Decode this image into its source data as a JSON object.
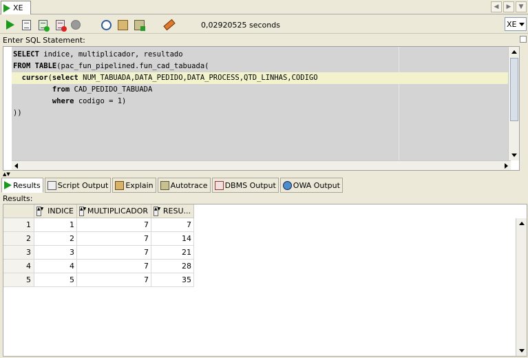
{
  "document_tab": {
    "label": "XE"
  },
  "toolbar": {
    "elapsed_time": "0,02920525 seconds",
    "connection": "XE"
  },
  "editor": {
    "label": "Enter SQL Statement:",
    "lines": [
      [
        {
          "t": "SELECT",
          "kw": true
        },
        {
          "t": " indice, multiplicador, resultado",
          "kw": false
        }
      ],
      [
        {
          "t": "FROM TABLE",
          "kw": true
        },
        {
          "t": "(pac_fun_pipelined.fun_cad_tabuada(",
          "kw": false
        }
      ],
      [
        {
          "t": "  cursor",
          "kw": true
        },
        {
          "t": "(",
          "kw": false
        },
        {
          "t": "select",
          "kw": true
        },
        {
          "t": " NUM_TABUADA,DATA_PEDIDO,DATA_PROCESS,QTD_LINHAS,CODIGO",
          "kw": false
        }
      ],
      [
        {
          "t": "         from",
          "kw": true
        },
        {
          "t": " CAD_PEDIDO_TABUADA",
          "kw": false
        }
      ],
      [
        {
          "t": "         where",
          "kw": true
        },
        {
          "t": " codigo = 1)",
          "kw": false
        }
      ],
      [
        {
          "t": "))",
          "kw": false
        }
      ]
    ]
  },
  "result_tabs": [
    {
      "label": "Results",
      "icon": "run-icon",
      "active": true
    },
    {
      "label": "Script Output",
      "icon": "script-output-icon",
      "active": false
    },
    {
      "label": "Explain",
      "icon": "explain-icon",
      "active": false
    },
    {
      "label": "Autotrace",
      "icon": "autotrace-icon",
      "active": false
    },
    {
      "label": "DBMS Output",
      "icon": "dbms-output-icon",
      "active": false
    },
    {
      "label": "OWA Output",
      "icon": "owa-output-icon",
      "active": false
    }
  ],
  "results": {
    "label": "Results:",
    "columns": [
      "INDICE",
      "MULTIPLICADOR",
      "RESU..."
    ],
    "rows": [
      {
        "n": "1",
        "cells": [
          "1",
          "7",
          "7"
        ]
      },
      {
        "n": "2",
        "cells": [
          "2",
          "7",
          "14"
        ]
      },
      {
        "n": "3",
        "cells": [
          "3",
          "7",
          "21"
        ]
      },
      {
        "n": "4",
        "cells": [
          "4",
          "7",
          "28"
        ]
      },
      {
        "n": "5",
        "cells": [
          "5",
          "7",
          "35"
        ]
      }
    ]
  }
}
